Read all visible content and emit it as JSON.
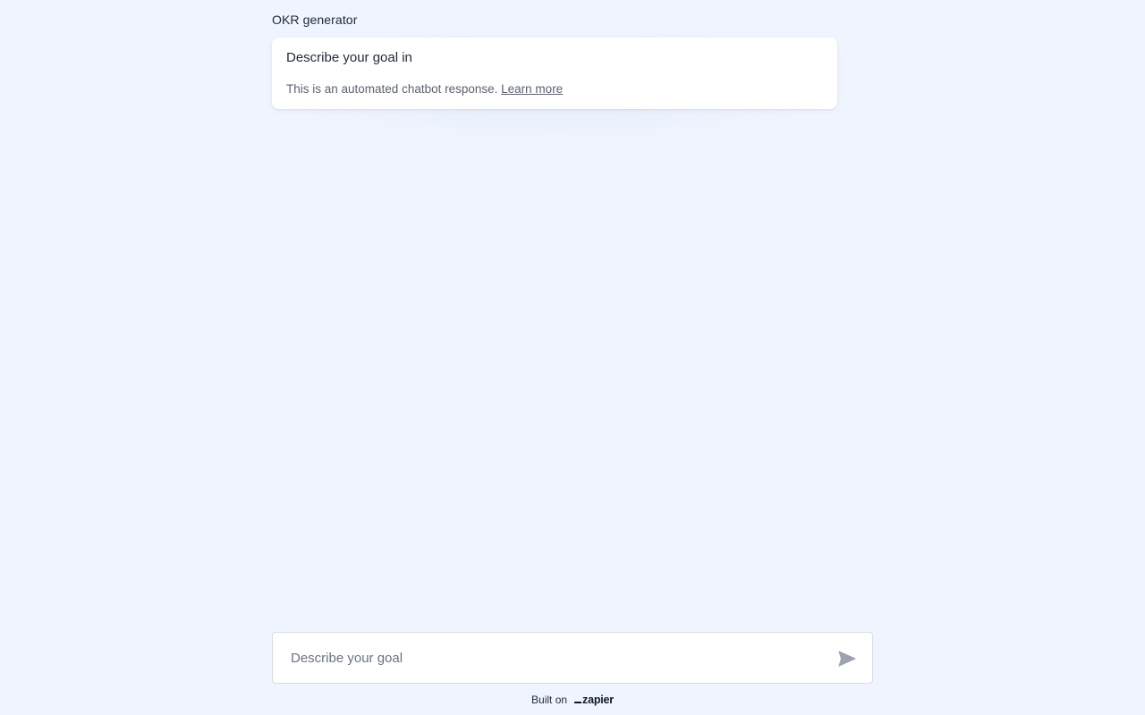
{
  "header": {
    "title": "OKR generator"
  },
  "message": {
    "text": "Describe your goal in",
    "note": "This is an automated chatbot response.",
    "link_label": "Learn more"
  },
  "composer": {
    "placeholder": "Describe your goal",
    "value": "",
    "send_icon": "send-icon"
  },
  "footer": {
    "label": "Built on",
    "logo_text": "zapier"
  },
  "colors": {
    "background": "#eff4fe",
    "card": "#ffffff",
    "send_icon": "#9ca3af"
  }
}
